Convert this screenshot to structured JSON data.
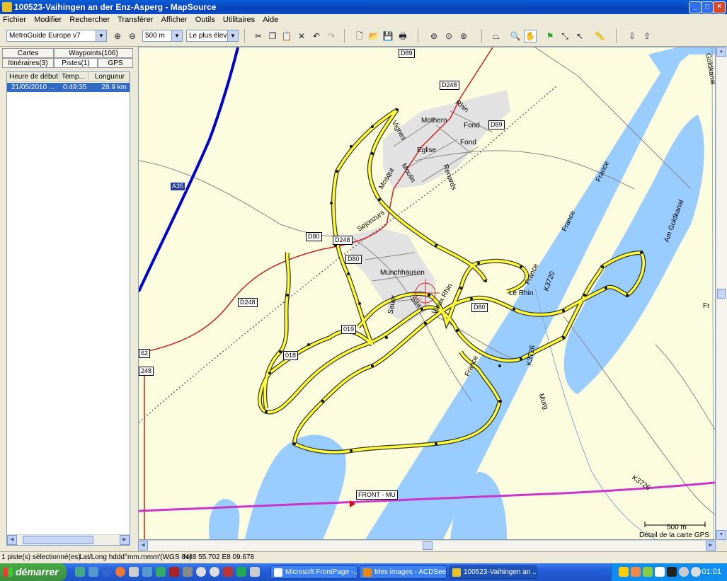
{
  "window": {
    "title": "100523-Vaihingen an der Enz-Asperg - MapSource",
    "controls": {
      "minimize": "_",
      "maximize": "□",
      "close": "×"
    }
  },
  "menu": [
    "Fichier",
    "Modifier",
    "Rechercher",
    "Transférer",
    "Afficher",
    "Outils",
    "Utilitaires",
    "Aide"
  ],
  "toolbar": {
    "map_product": "MetroGuide Europe v7",
    "zoom_level": "500 m",
    "detail_level": "Le plus élevé"
  },
  "left_panel": {
    "tabs_row1": [
      "Cartes",
      "Waypoints(106)"
    ],
    "tabs_row2": [
      "Itinéraires(3)",
      "Pistes(1)",
      "GPS"
    ],
    "active_tab": "Pistes(1)",
    "columns": [
      "Heure de début",
      "Temp...",
      "Longueur"
    ],
    "rows": [
      {
        "start": "21/05/2010 ...",
        "duration": "0:49:35",
        "length": "28.9 km"
      }
    ]
  },
  "map": {
    "place_labels": [
      {
        "text": "Mothern"
      },
      {
        "text": "Eglise"
      },
      {
        "text": "Fond"
      },
      {
        "text": "Fond"
      },
      {
        "text": "Vignes"
      },
      {
        "text": "Rhin"
      },
      {
        "text": "Renards"
      },
      {
        "text": "Moulin"
      },
      {
        "text": "Mosqut"
      },
      {
        "text": "Sejonzurs"
      },
      {
        "text": "Munchhausen"
      },
      {
        "text": "Sauer"
      },
      {
        "text": "Sita"
      },
      {
        "text": "Vieux Rhin"
      },
      {
        "text": "Le Rhin"
      },
      {
        "text": "France"
      },
      {
        "text": "France"
      },
      {
        "text": "France"
      },
      {
        "text": "France"
      },
      {
        "text": "Am Goldkanal"
      },
      {
        "text": "Goldkanal"
      },
      {
        "text": "Murg"
      },
      {
        "text": "Fr"
      }
    ],
    "road_labels": [
      "D89",
      "D248",
      "D89",
      "A35",
      "D80",
      "D248",
      "D80",
      "D248",
      "D80",
      "019",
      "018",
      "K3720",
      "K3726",
      "K3726",
      "62",
      "248"
    ],
    "waypoint": "FRONT - MU",
    "scale": "500 m",
    "detail_text": "Détail de la carte GPS"
  },
  "status_bar": {
    "selection": "1 piste(s) sélectionné(es)",
    "format": "Lat/Long hddd°mm.mmm'(WGS 84)",
    "position": "N48 55.702 E8 09.678"
  },
  "taskbar": {
    "start": "démarrer",
    "tasks": [
      "Microsoft FrontPage -...",
      "Mes images - ACDSee...",
      "100523-Vaihingen an ..."
    ],
    "clock": "01:01"
  },
  "colors": {
    "track": "#ffff33",
    "water": "#99ccff",
    "highway": "#0000cc",
    "border": "#cc33cc",
    "road": "#cc2222"
  }
}
